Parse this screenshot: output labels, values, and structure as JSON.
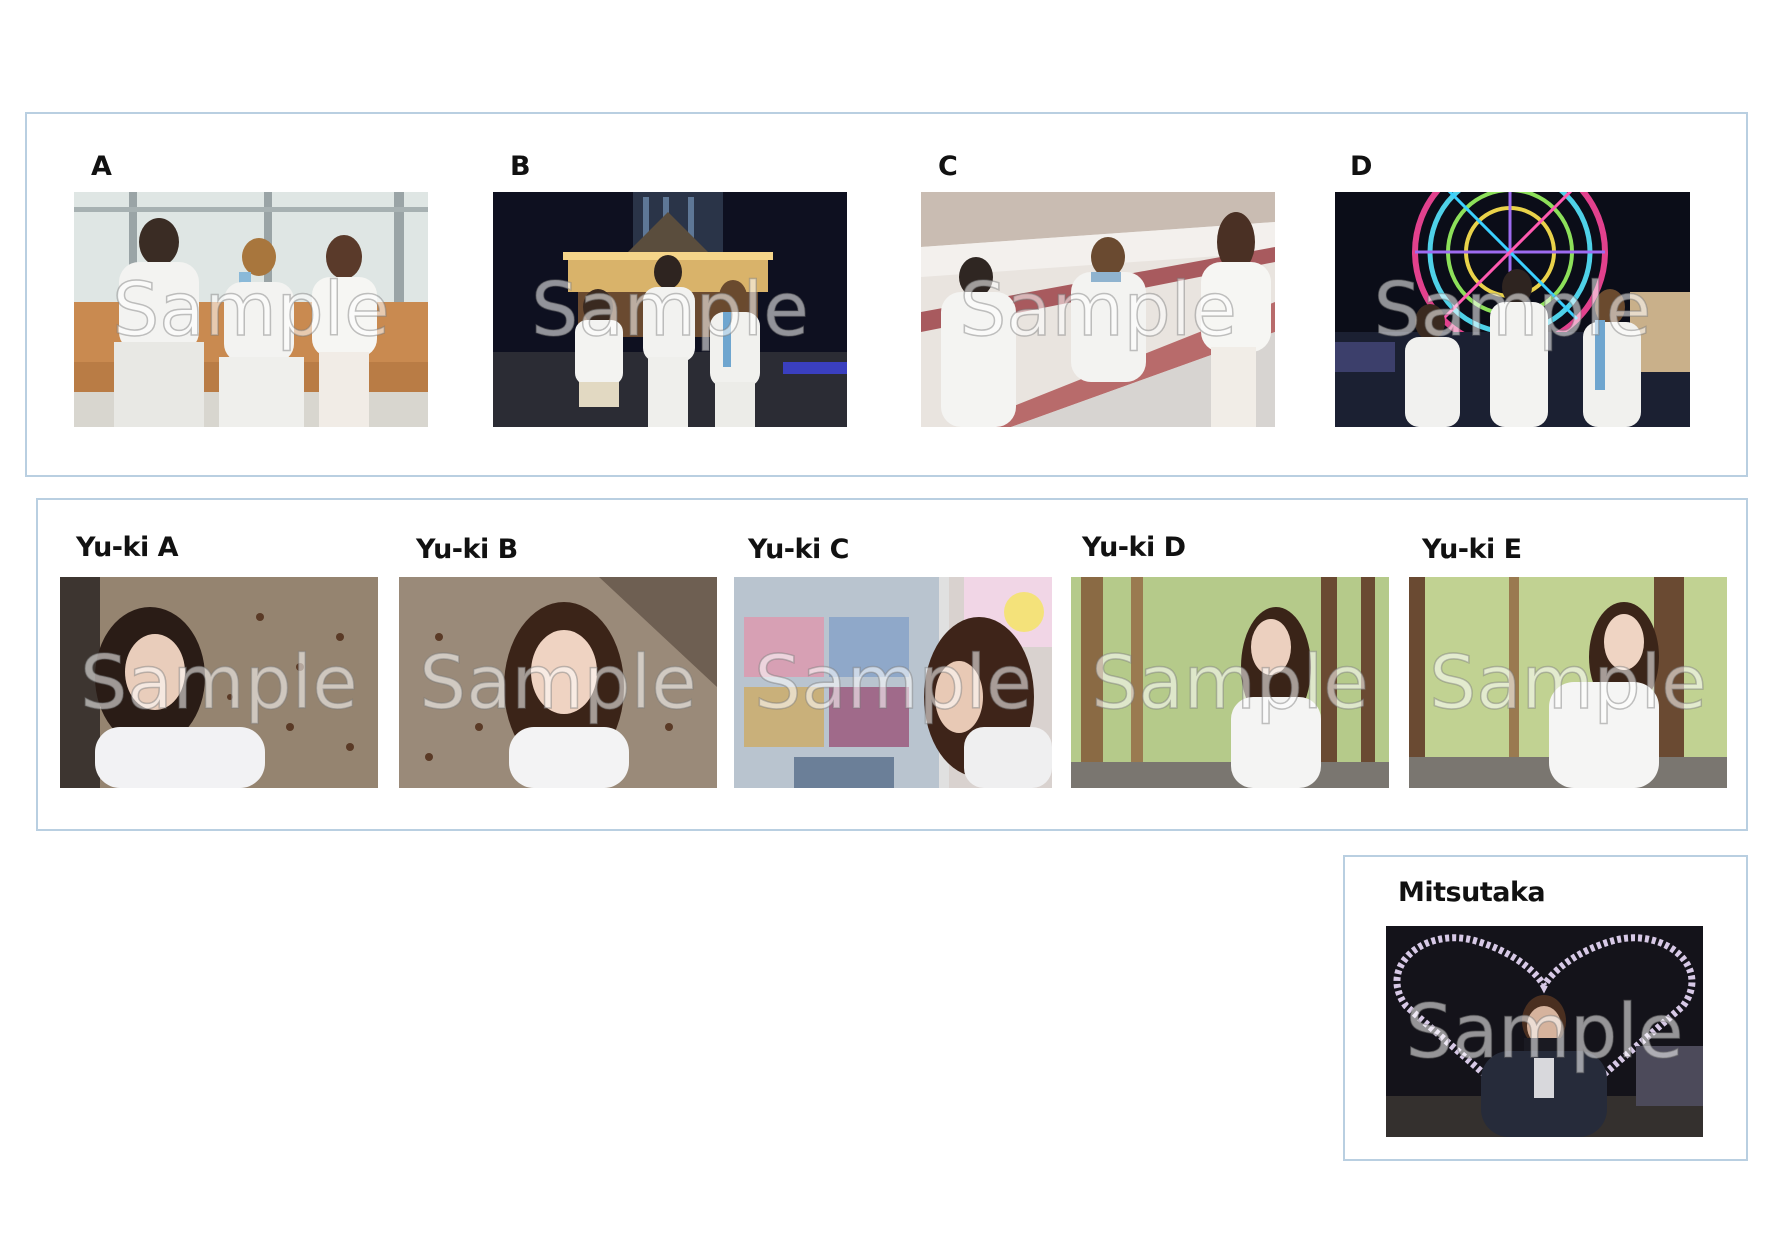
{
  "watermark": "Sample",
  "group_photos": [
    {
      "label": "A"
    },
    {
      "label": "B"
    },
    {
      "label": "C"
    },
    {
      "label": "D"
    }
  ],
  "yuki_photos": [
    {
      "label": "Yu-ki A"
    },
    {
      "label": "Yu-ki B"
    },
    {
      "label": "Yu-ki C"
    },
    {
      "label": "Yu-ki D"
    },
    {
      "label": "Yu-ki  E"
    }
  ],
  "mitsutaka_photo": {
    "label": "Mitsutaka"
  },
  "colors": {
    "panel_border": "#b9cfe1"
  }
}
